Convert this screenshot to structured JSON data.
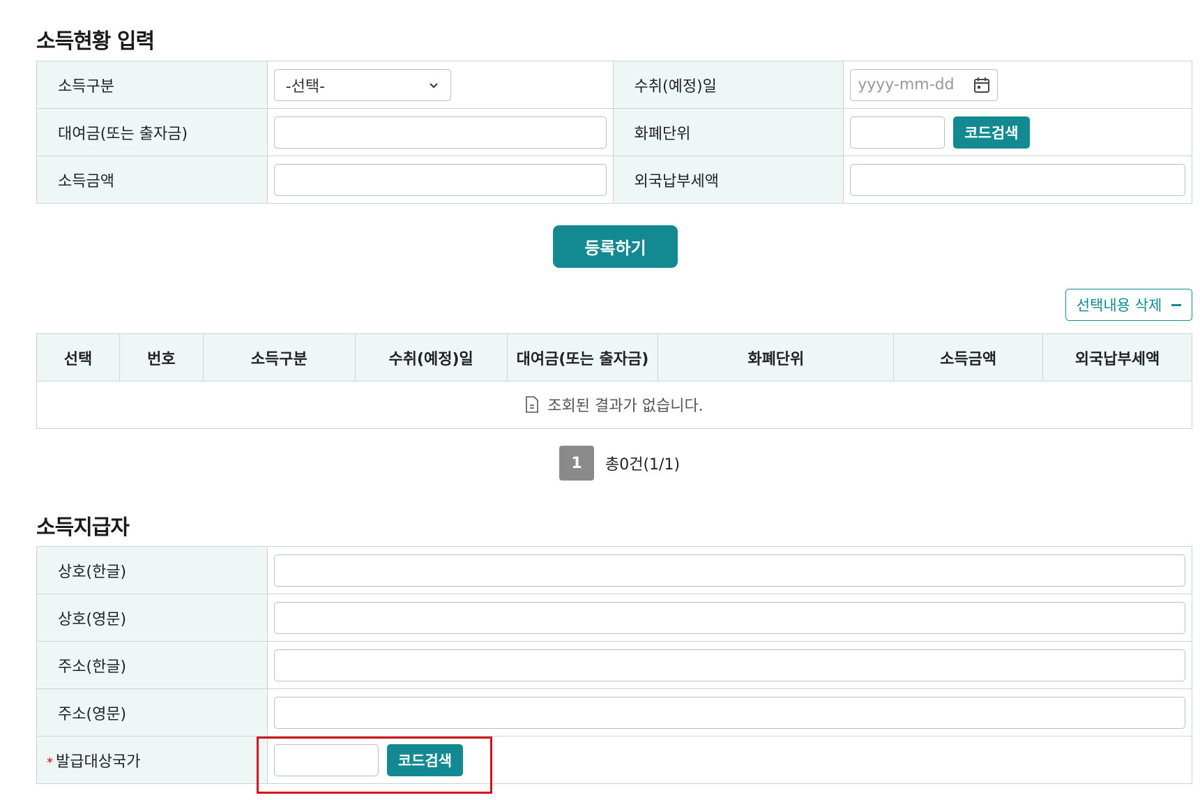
{
  "income_input": {
    "title": "소득현황 입력",
    "income_type_label": "소득구분",
    "income_type_value": "-선택-",
    "receipt_date_label": "수취(예정)일",
    "receipt_date_placeholder": "yyyy-mm-dd",
    "loan_label": "대여금(또는 출자금)",
    "currency_label": "화폐단위",
    "code_search_label": "코드검색",
    "income_amount_label": "소득금액",
    "foreign_tax_label": "외국납부세액",
    "register_label": "등록하기"
  },
  "list": {
    "delete_selected_label": "선택내용 삭제",
    "headers": [
      "선택",
      "번호",
      "소득구분",
      "수취(예정)일",
      "대여금(또는 출자금)",
      "화폐단위",
      "소득금액",
      "외국납부세액"
    ],
    "empty_message": "조회된 결과가 없습니다.",
    "page": "1",
    "total": "총0건(1/1)"
  },
  "payer": {
    "title": "소득지급자",
    "name_kr_label": "상호(한글)",
    "name_en_label": "상호(영문)",
    "addr_kr_label": "주소(한글)",
    "addr_en_label": "주소(영문)",
    "country_label": "발급대상국가",
    "required_mark": "*",
    "code_search_label": "코드검색"
  },
  "colors": {
    "accent": "#138a92",
    "label_bg": "#eef7f6",
    "highlight": "#d0121f"
  }
}
